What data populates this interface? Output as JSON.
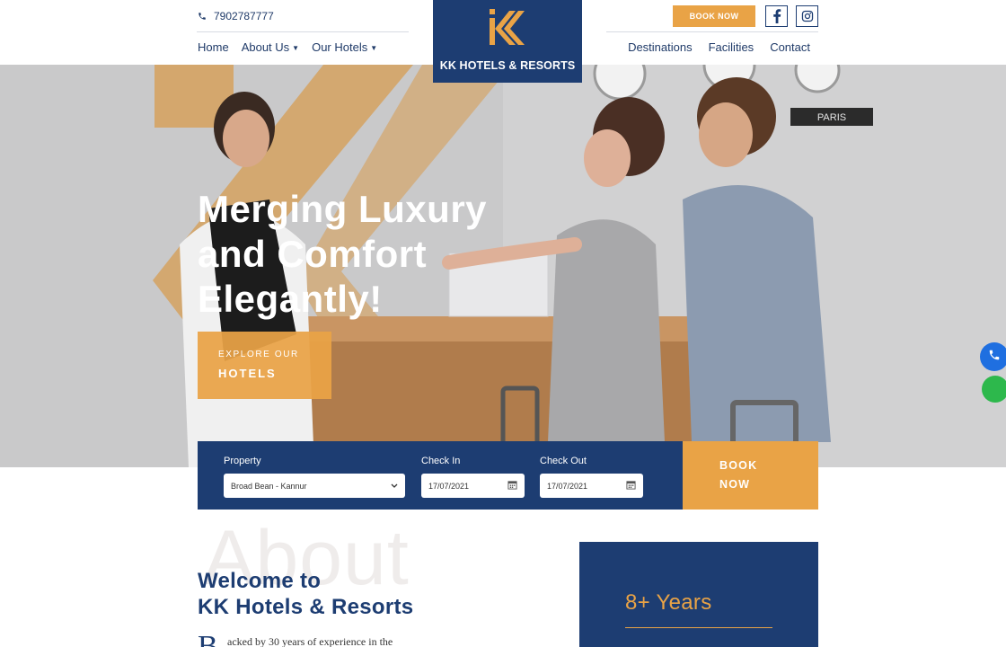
{
  "header": {
    "phone": "7902787777",
    "phone_icon": "phone-icon",
    "nav_left": [
      {
        "label": "Home",
        "dropdown": false
      },
      {
        "label": "About Us",
        "dropdown": true
      },
      {
        "label": "Our Hotels",
        "dropdown": true
      }
    ],
    "nav_right": [
      {
        "label": "Destinations"
      },
      {
        "label": "Facilities"
      },
      {
        "label": "Contact"
      }
    ],
    "book_now": "BOOK NOW",
    "social": [
      "facebook-icon",
      "instagram-icon"
    ]
  },
  "logo": {
    "text": "KK HOTELS & RESORTS",
    "mark": "KK",
    "accent": "#e9a346",
    "brand": "#1d3d72"
  },
  "hero": {
    "title_line1": "Merging Luxury",
    "title_line2": "and Comfort",
    "title_line3": "Elegantly!",
    "cta_line1": "EXPLORE OUR",
    "cta_line2": "HOTELS",
    "sign_text": "PARIS"
  },
  "booking": {
    "property_label": "Property",
    "property_value": "Broad Bean - Kannur",
    "checkin_label": "Check In",
    "checkin_value": "17/07/2021",
    "checkout_label": "Check Out",
    "checkout_value": "17/07/2021",
    "book_line1": "BOOK",
    "book_line2": "NOW"
  },
  "about": {
    "bg_word": "About",
    "welcome_line1": "Welcome to",
    "welcome_line2": "KK Hotels & Resorts",
    "dropcap": "B",
    "text": "acked by 30 years of experience in the",
    "years": "8+ Years"
  }
}
